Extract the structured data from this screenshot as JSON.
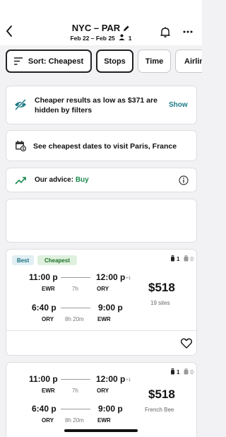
{
  "header": {
    "route": "NYC – PAR",
    "dates": "Feb 22 – Feb 25",
    "travelers": "1"
  },
  "chips": [
    {
      "label": "Sort: Cheapest",
      "active": true
    },
    {
      "label": "Stops",
      "active": true
    },
    {
      "label": "Time",
      "active": false
    },
    {
      "label": "Airlin",
      "active": false
    }
  ],
  "banners": {
    "hidden": {
      "text": "Cheaper results as low as $371 are hidden by filters",
      "action": "Show"
    },
    "dates": {
      "text": "See cheapest dates to visit Paris, France"
    },
    "advice": {
      "label": "Our advice:",
      "value": "Buy"
    }
  },
  "flights": [
    {
      "tags": [
        "Best",
        "Cheapest"
      ],
      "carry_on": "1",
      "checked": "0",
      "outbound": {
        "dep_time": "11:00 p",
        "arr_time": "12:00 p",
        "plus_days": "+1",
        "dep_airport": "EWR",
        "arr_airport": "ORY",
        "duration": "7h"
      },
      "return": {
        "dep_time": "6:40 p",
        "arr_time": "9:00 p",
        "dep_airport": "ORY",
        "arr_airport": "EWR",
        "duration": "8h 20m"
      },
      "price": "$518",
      "provider": "19 sites"
    },
    {
      "tags": [],
      "carry_on": "1",
      "checked": "0",
      "outbound": {
        "dep_time": "11:00 p",
        "arr_time": "12:00 p",
        "plus_days": "+1",
        "dep_airport": "EWR",
        "arr_airport": "ORY",
        "duration": "7h"
      },
      "return": {
        "dep_time": "6:40 p",
        "arr_time": "9:00 p",
        "dep_airport": "ORY",
        "arr_airport": "EWR",
        "duration": "8h 20m"
      },
      "price": "$518",
      "provider": "French Bee"
    }
  ],
  "colors": {
    "accent": "#1c7a86",
    "buy": "#1c8a4f",
    "best_tag_bg": "#e1eff4",
    "cheapest_tag_bg": "#dff1de"
  },
  "icons": [
    "back-arrow-icon",
    "pencil-icon",
    "person-icon",
    "bell-icon",
    "more-icon",
    "sort-icon",
    "eye-off-icon",
    "calendar-icon",
    "trend-up-icon",
    "info-icon",
    "carry-on-bag-icon",
    "checked-bag-icon",
    "heart-icon"
  ]
}
